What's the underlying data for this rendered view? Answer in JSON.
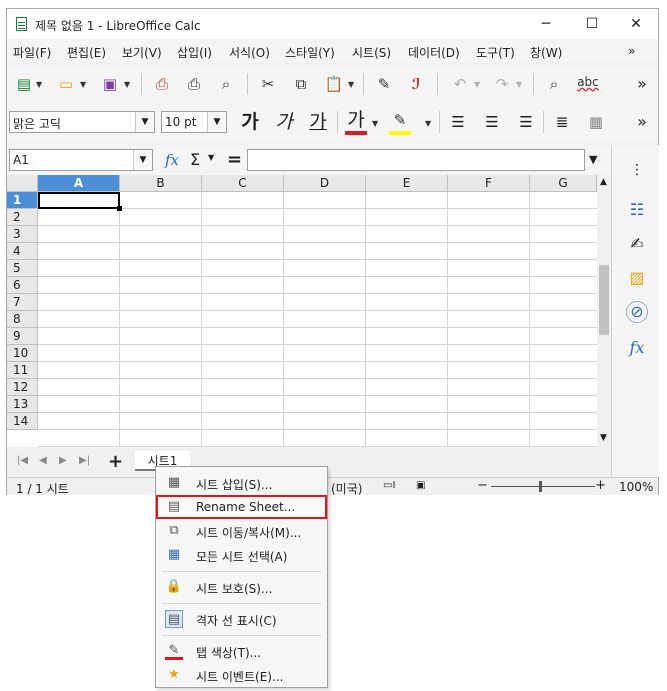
{
  "window": {
    "title": "제목 없음 1 - LibreOffice Calc",
    "minimize": "─",
    "maximize": "☐",
    "close": "✕"
  },
  "menu": [
    "파일(F)",
    "편집(E)",
    "보기(V)",
    "삽입(I)",
    "서식(O)",
    "스타일(Y)",
    "시트(S)",
    "데이터(D)",
    "도구(T)",
    "창(W)"
  ],
  "menu_more": "»",
  "toolbar": {
    "more": "»",
    "font_name": "맑은 고딕",
    "font_size": "10 pt",
    "bold_glyph": "가",
    "italic_glyph": "가",
    "underline_glyph": "가",
    "font_color_glyph": "가",
    "spell_glyph": "abc",
    "font_color": "#d9191f",
    "highlight_color": "#ffff00"
  },
  "formula_bar": {
    "name_box": "A1",
    "fx": "fx",
    "sigma": "Σ",
    "equals": "=",
    "input": ""
  },
  "columns": [
    "A",
    "B",
    "C",
    "D",
    "E",
    "F",
    "G"
  ],
  "rows": [
    "1",
    "2",
    "3",
    "4",
    "5",
    "6",
    "7",
    "8",
    "9",
    "10",
    "11",
    "12",
    "13",
    "14"
  ],
  "selected_cell": "A1",
  "sheet_tabs": {
    "add": "+",
    "active": "시트1"
  },
  "status_bar": {
    "sheet": "1 / 1 시트",
    "language": "(미국)",
    "zoom_minus": "−",
    "zoom_plus": "+",
    "zoom": "100%"
  },
  "sidebar": {
    "more": "⋮",
    "fx": "fx"
  },
  "context_menu": {
    "items": [
      {
        "label": "시트 삽입(S)...",
        "icon": "insert-sheet-icon"
      },
      {
        "label": "Rename Sheet...",
        "icon": "rename-sheet-icon",
        "highlighted": true
      },
      {
        "label": "시트 이동/복사(M)...",
        "icon": "move-copy-sheet-icon"
      },
      {
        "label": "모든 시트 선택(A)",
        "icon": "select-all-sheets-icon"
      },
      {
        "label": "시트 보호(S)...",
        "icon": "lock-icon"
      },
      {
        "label": "격자 선 표시(C)",
        "icon": "grid-lines-icon"
      },
      {
        "label": "탭 색상(T)...",
        "icon": "tab-color-icon"
      },
      {
        "label": "시트 이벤트(E)...",
        "icon": "sheet-events-icon"
      }
    ],
    "highlight_color": "#d9191f"
  }
}
